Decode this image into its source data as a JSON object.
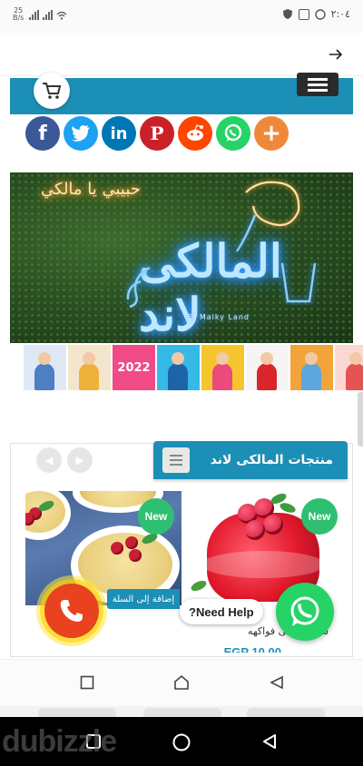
{
  "status_bar": {
    "speed_value": "25",
    "speed_unit": "B/s",
    "time": "٢:٠٤"
  },
  "share_buttons": [
    {
      "name": "facebook",
      "glyph": "f",
      "color": "#3b5998"
    },
    {
      "name": "twitter",
      "glyph": "t",
      "color": "#1da1f2"
    },
    {
      "name": "linkedin",
      "glyph": "in",
      "color": "#0077b5"
    },
    {
      "name": "pinterest",
      "glyph": "P",
      "color": "#cb2027"
    },
    {
      "name": "reddit",
      "glyph": "r",
      "color": "#ff4500"
    },
    {
      "name": "whatsapp",
      "glyph": "w",
      "color": "#25d366"
    },
    {
      "name": "more",
      "glyph": "+",
      "color": "#f0883a"
    }
  ],
  "banner": {
    "arabic_sign": "المالكى لاند",
    "english_sign": "El Malky Land",
    "gold_sign": "حبيبي يا مالكي"
  },
  "thumbnails": {
    "year_label": "2022"
  },
  "products": {
    "section_title": "منتجات المالكى لاند",
    "items": [
      {
        "badge": "New",
        "add_to_cart": "إضافة إلى السلة"
      },
      {
        "badge": "New",
        "name": "سادة – جلى فواكهه",
        "price": "EGP 10.00"
      }
    ]
  },
  "floating": {
    "help_text": "?Need Help"
  },
  "watermark": "dubizzle"
}
